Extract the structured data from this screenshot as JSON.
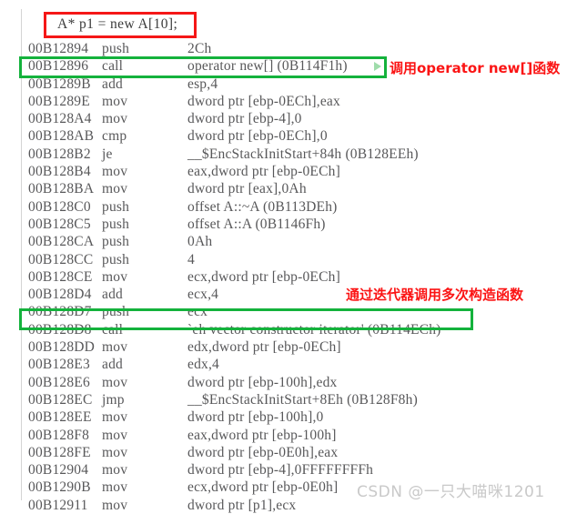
{
  "editor": {
    "source_line": "A* p1 = new A[10];",
    "gutter_present": true
  },
  "colors": {
    "red_box": "#f51717",
    "green_box": "#14b23c",
    "annotation_red": "#fb1414",
    "code_text": "#58585a",
    "source_text": "#3a3a3a",
    "watermark": "#c9c9c9",
    "background": "#ffffff"
  },
  "disassembly": {
    "columns": [
      "address",
      "mnemonic",
      "operands"
    ],
    "rows": [
      {
        "address": "00B12894",
        "mnemonic": "push",
        "operands": "2Ch"
      },
      {
        "address": "00B12896",
        "mnemonic": "call",
        "operands": "operator new[] (0B114F1h)"
      },
      {
        "address": "00B1289B",
        "mnemonic": "add",
        "operands": "esp,4"
      },
      {
        "address": "00B1289E",
        "mnemonic": "mov",
        "operands": "dword ptr [ebp-0ECh],eax"
      },
      {
        "address": "00B128A4",
        "mnemonic": "mov",
        "operands": "dword ptr [ebp-4],0"
      },
      {
        "address": "00B128AB",
        "mnemonic": "cmp",
        "operands": "dword ptr [ebp-0ECh],0"
      },
      {
        "address": "00B128B2",
        "mnemonic": "je",
        "operands": "__$EncStackInitStart+84h (0B128EEh)"
      },
      {
        "address": "00B128B4",
        "mnemonic": "mov",
        "operands": "eax,dword ptr [ebp-0ECh]"
      },
      {
        "address": "00B128BA",
        "mnemonic": "mov",
        "operands": "dword ptr [eax],0Ah"
      },
      {
        "address": "00B128C0",
        "mnemonic": "push",
        "operands": "offset A::~A (0B113DEh)"
      },
      {
        "address": "00B128C5",
        "mnemonic": "push",
        "operands": "offset A::A (0B1146Fh)"
      },
      {
        "address": "00B128CA",
        "mnemonic": "push",
        "operands": "0Ah"
      },
      {
        "address": "00B128CC",
        "mnemonic": "push",
        "operands": "4"
      },
      {
        "address": "00B128CE",
        "mnemonic": "mov",
        "operands": "ecx,dword ptr [ebp-0ECh]"
      },
      {
        "address": "00B128D4",
        "mnemonic": "add",
        "operands": "ecx,4"
      },
      {
        "address": "00B128D7",
        "mnemonic": "push",
        "operands": "ecx"
      },
      {
        "address": "00B128D8",
        "mnemonic": "call",
        "operands": "`eh vector constructor iterator' (0B114ECh)"
      },
      {
        "address": "00B128DD",
        "mnemonic": "mov",
        "operands": "edx,dword ptr [ebp-0ECh]"
      },
      {
        "address": "00B128E3",
        "mnemonic": "add",
        "operands": "edx,4"
      },
      {
        "address": "00B128E6",
        "mnemonic": "mov",
        "operands": "dword ptr [ebp-100h],edx"
      },
      {
        "address": "00B128EC",
        "mnemonic": "jmp",
        "operands": "__$EncStackInitStart+8Eh (0B128F8h)"
      },
      {
        "address": "00B128EE",
        "mnemonic": "mov",
        "operands": "dword ptr [ebp-100h],0"
      },
      {
        "address": "00B128F8",
        "mnemonic": "mov",
        "operands": "eax,dword ptr [ebp-100h]"
      },
      {
        "address": "00B128FE",
        "mnemonic": "mov",
        "operands": "dword ptr [ebp-0E0h],eax"
      },
      {
        "address": "00B12904",
        "mnemonic": "mov",
        "operands": "dword ptr [ebp-4],0FFFFFFFFh"
      },
      {
        "address": "00B1290B",
        "mnemonic": "mov",
        "operands": "ecx,dword ptr [ebp-0E0h]"
      },
      {
        "address": "00B12911",
        "mnemonic": "mov",
        "operands": "dword ptr [p1],ecx"
      }
    ]
  },
  "annotations": [
    {
      "id": "annotation-1",
      "text": "调用operator new[]函数"
    },
    {
      "id": "annotation-2",
      "text": "通过迭代器调用多次构造函数"
    }
  ],
  "icons": {
    "step_into": "step-into-triangle-icon"
  },
  "watermark": {
    "text": "CSDN @一只大喵咪1201"
  }
}
